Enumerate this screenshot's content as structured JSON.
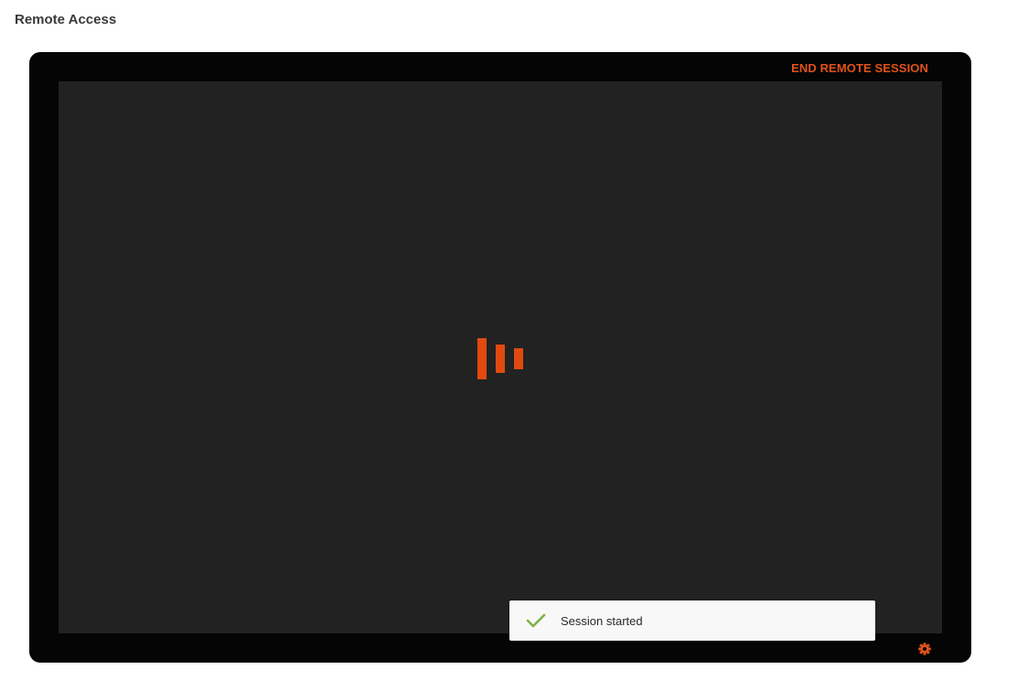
{
  "header": {
    "title": "Remote Access"
  },
  "session": {
    "end_label": "END REMOTE SESSION",
    "accent_color": "#e0521a"
  },
  "icons": {
    "loader": "loading-bars-icon",
    "settings": "gear-icon",
    "toast": "checkmark-icon"
  },
  "toast": {
    "message": "Session started",
    "status_color": "#7cb342"
  }
}
